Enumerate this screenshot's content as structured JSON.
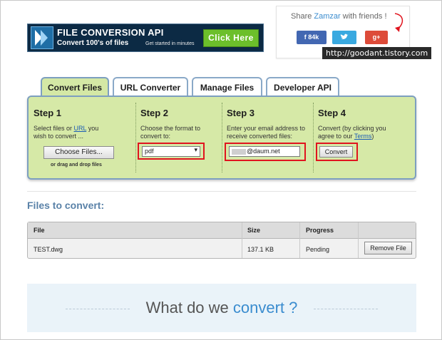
{
  "banner": {
    "title": "FILE CONVERSION API",
    "subtitle": "Convert 100's of files",
    "tagline": "Get started in minutes",
    "cta_label": "Click Here"
  },
  "share": {
    "prefix": "Share ",
    "brand": "Zamzar",
    "suffix": " with friends !",
    "facebook_label": "f  84k",
    "twitter_icon": "twitter-bird-icon",
    "google_label": "g+"
  },
  "watermark": "http://goodant.tistory.com",
  "tabs": [
    {
      "label": "Convert Files",
      "active": true
    },
    {
      "label": "URL Converter",
      "active": false
    },
    {
      "label": "Manage Files",
      "active": false
    },
    {
      "label": "Developer API",
      "active": false
    }
  ],
  "steps": {
    "step1": {
      "title": "Step 1",
      "text_a": "Select files or ",
      "link": "URL",
      "text_b": " you",
      "text_c": "wish to convert ...",
      "button": "Choose Files...",
      "note": "or drag and drop files"
    },
    "step2": {
      "title": "Step 2",
      "text_a": "Choose the format to",
      "text_b": "convert to:",
      "format_value": "pdf"
    },
    "step3": {
      "title": "Step 3",
      "text_a": "Enter your email address to",
      "text_b": "receive converted files:",
      "email_value": "@daum.net"
    },
    "step4": {
      "title": "Step 4",
      "text_a": "Convert (by clicking you",
      "text_b": "agree to our ",
      "link": "Terms",
      "text_c": ")",
      "button": "Convert"
    }
  },
  "files": {
    "section_title": "Files to convert:",
    "headers": {
      "file": "File",
      "size": "Size",
      "progress": "Progress"
    },
    "rows": [
      {
        "file": "TEST.dwg",
        "size": "137.1 KB",
        "progress": "Pending",
        "action": "Remove File"
      }
    ]
  },
  "promo": {
    "prefix": "What do we ",
    "accent": "convert ?"
  },
  "colors": {
    "panel_bg": "#d6e9a7",
    "panel_border": "#7d9fc0",
    "highlight_box": "#e0141e",
    "link": "#1a5cb5",
    "section_title": "#5a82a8"
  }
}
